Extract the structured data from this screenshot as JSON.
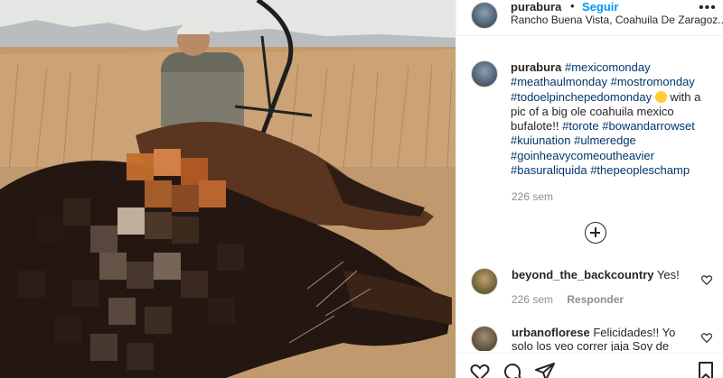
{
  "post": {
    "username": "purabura",
    "dot": "•",
    "follow_label": "Seguir",
    "location": "Rancho Buena Vista, Coahuila De Zaragoz..."
  },
  "caption": {
    "username": "purabura",
    "tag_1": "#mexicomonday",
    "tag_2": "#meathaulmonday",
    "tag_3": "#mostromonday",
    "tag_4": "#todoelpinchepedomonday",
    "text_1": "with a pic of a big ole coahuila mexico bufalote!!",
    "tag_5": "#torote",
    "tag_6": "#bowandarrowset",
    "tag_7": "#kuiunation",
    "tag_8": "#ulmeredge",
    "tag_9": "#goinheavycomeoutheavier",
    "tag_10": "#basuraliquida",
    "tag_11": "#thepeopleschamp",
    "time": "226 sem"
  },
  "comments": [
    {
      "username": "beyond_the_backcountry",
      "text": "Yes!",
      "time": "226 sem",
      "reply_label": "Responder"
    },
    {
      "username": "urbanoflorese",
      "text": "Felicidades!! Yo solo los veo correr jaja Soy de"
    }
  ],
  "icons": {
    "more": "more-icon",
    "load_more": "plus-circle-icon",
    "like": "heart-icon",
    "comment": "comment-icon",
    "share": "share-icon",
    "save": "bookmark-icon"
  },
  "colors": {
    "accent": "#0095f6",
    "hashtag": "#00376b",
    "muted": "#8e8e8e"
  }
}
